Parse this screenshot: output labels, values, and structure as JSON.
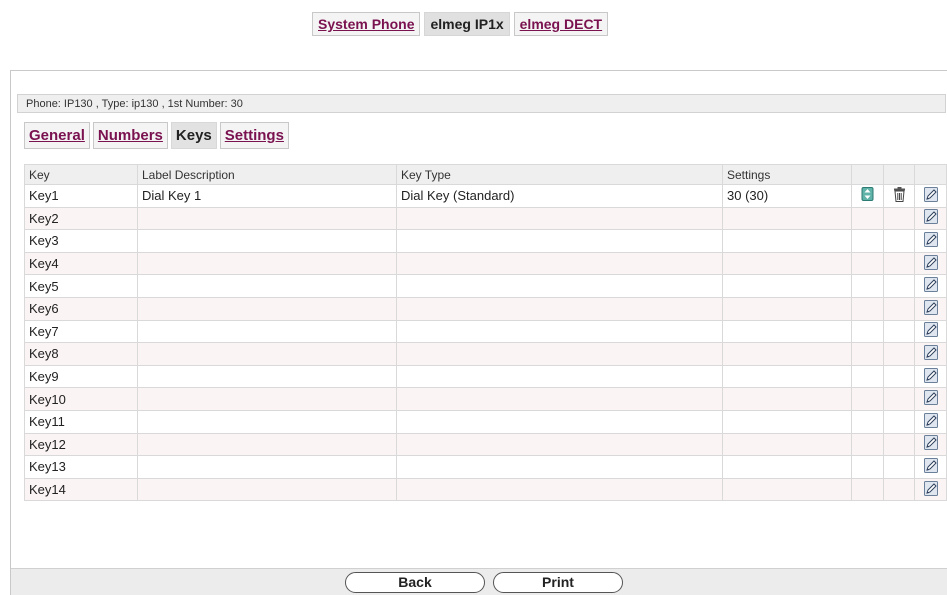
{
  "top_tabs": [
    {
      "label": "System Phone",
      "active": false
    },
    {
      "label": "elmeg IP1x",
      "active": true
    },
    {
      "label": "elmeg DECT",
      "active": false
    }
  ],
  "phone_info": "Phone: IP130 , Type: ip130 , 1st Number: 30",
  "sub_tabs": [
    {
      "label": "General",
      "active": false
    },
    {
      "label": "Numbers",
      "active": false
    },
    {
      "label": "Keys",
      "active": true
    },
    {
      "label": "Settings",
      "active": false
    }
  ],
  "table": {
    "headers": {
      "key": "Key",
      "label": "Label Description",
      "type": "Key Type",
      "settings": "Settings"
    },
    "rows": [
      {
        "key": "Key1",
        "label": "Dial Key 1",
        "type": "Dial Key (Standard)",
        "settings": "30 (30)",
        "has_move": true,
        "has_delete": true
      },
      {
        "key": "Key2",
        "label": "",
        "type": "",
        "settings": ""
      },
      {
        "key": "Key3",
        "label": "",
        "type": "",
        "settings": ""
      },
      {
        "key": "Key4",
        "label": "",
        "type": "",
        "settings": ""
      },
      {
        "key": "Key5",
        "label": "",
        "type": "",
        "settings": ""
      },
      {
        "key": "Key6",
        "label": "",
        "type": "",
        "settings": ""
      },
      {
        "key": "Key7",
        "label": "",
        "type": "",
        "settings": ""
      },
      {
        "key": "Key8",
        "label": "",
        "type": "",
        "settings": ""
      },
      {
        "key": "Key9",
        "label": "",
        "type": "",
        "settings": ""
      },
      {
        "key": "Key10",
        "label": "",
        "type": "",
        "settings": ""
      },
      {
        "key": "Key11",
        "label": "",
        "type": "",
        "settings": ""
      },
      {
        "key": "Key12",
        "label": "",
        "type": "",
        "settings": ""
      },
      {
        "key": "Key13",
        "label": "",
        "type": "",
        "settings": ""
      },
      {
        "key": "Key14",
        "label": "",
        "type": "",
        "settings": ""
      }
    ]
  },
  "buttons": {
    "back": "Back",
    "print": "Print"
  },
  "icons": {
    "move": "move-updown-icon",
    "delete": "trash-icon",
    "edit": "edit-pencil-icon"
  },
  "colors": {
    "link": "#7a1250",
    "row_alt": "#fbf4f5",
    "header_bg": "#efefef"
  }
}
